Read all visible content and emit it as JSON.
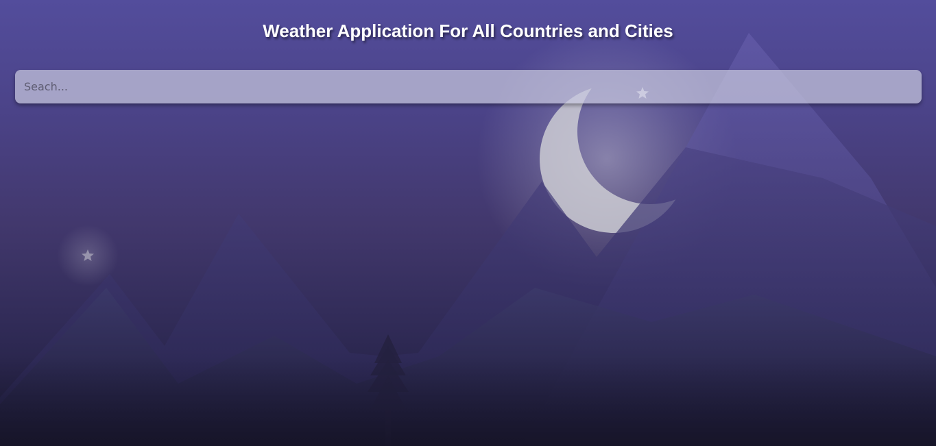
{
  "header": {
    "title": "Weather Application For All Countries and Cities"
  },
  "search": {
    "placeholder": "Seach...",
    "value": ""
  },
  "colors": {
    "sky_top": "#534d9c",
    "sky_bottom": "#1c1a35",
    "moon": "#cfcfcf",
    "title_text": "#ffffff"
  },
  "icons": {
    "moon": "crescent-moon-icon",
    "star": "star-icon",
    "tree": "pine-tree-icon"
  }
}
